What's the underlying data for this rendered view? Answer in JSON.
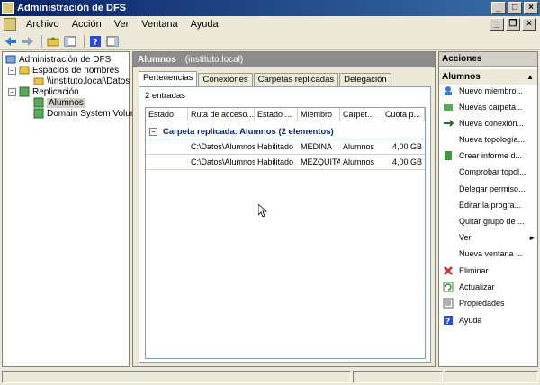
{
  "window": {
    "title": "Administración de DFS"
  },
  "menu": {
    "items": [
      "Archivo",
      "Acción",
      "Ver",
      "Ventana",
      "Ayuda"
    ]
  },
  "toolbar": {
    "icons": [
      "back-icon",
      "forward-icon",
      "up-folder-icon",
      "show-tree-icon",
      "help-icon",
      "properties-icon"
    ]
  },
  "tree": {
    "root": "Administración de DFS",
    "namespaces": "Espacios de nombres",
    "namespace_item": "\\\\instituto.local\\Datos",
    "replication": "Replicación",
    "group_alumnos": "Alumnos",
    "group_domain": "Domain System Volume"
  },
  "center": {
    "title": "Alumnos",
    "subtitle": "(instituto.local)",
    "tabs": [
      "Pertenencias",
      "Conexiones",
      "Carpetas replicadas",
      "Delegación"
    ],
    "entries": "2 entradas",
    "columns": [
      "Estado",
      "Ruta de acceso...",
      "Estado ...",
      "Miembro",
      "Carpet...",
      "Cuota p..."
    ],
    "group_label": "Carpeta replicada: Alumnos (2 elementos)",
    "rows": [
      {
        "estado": "",
        "ruta": "C:\\Datos\\Alumnos",
        "estado2": "Habilitado",
        "miembro": "MEDINA",
        "carpeta": "Alumnos",
        "cuota": "4,00 GB"
      },
      {
        "estado": "",
        "ruta": "C:\\Datos\\Alumnos",
        "estado2": "Habilitado",
        "miembro": "MEZQUITA",
        "carpeta": "Alumnos",
        "cuota": "4,00 GB"
      }
    ]
  },
  "actions": {
    "header": "Acciones",
    "section": "Alumnos",
    "items": [
      "Nuevo miembro...",
      "Nuevas carpeta...",
      "Nueva conexión...",
      "Nueva topología...",
      "Crear informe d...",
      "Comprobar topol...",
      "Delegar permiso...",
      "Editar la progra...",
      "Quitar grupo de ...",
      "Ver",
      "Nueva ventana ...",
      "Eliminar",
      "Actualizar",
      "Propiedades",
      "Ayuda"
    ]
  }
}
